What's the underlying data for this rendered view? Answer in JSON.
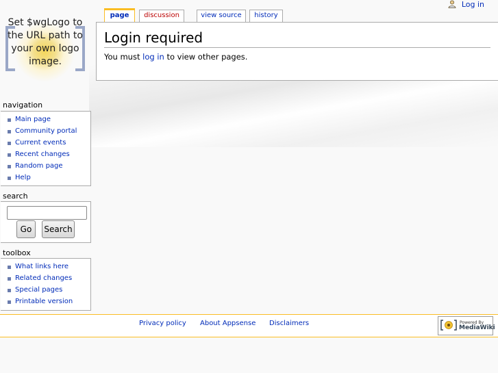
{
  "logo": {
    "text": "Set $wgLogo to the URL path to your own logo image."
  },
  "personal": {
    "login": "Log in"
  },
  "tabs": [
    {
      "label": "page"
    },
    {
      "label": "discussion"
    },
    {
      "label": "view source"
    },
    {
      "label": "history"
    }
  ],
  "content": {
    "title": "Login required",
    "body_pre": "You must ",
    "body_link": "log in",
    "body_post": " to view other pages."
  },
  "navigation": {
    "title": "navigation",
    "items": [
      "Main page",
      "Community portal",
      "Current events",
      "Recent changes",
      "Random page",
      "Help"
    ]
  },
  "search": {
    "title": "search",
    "go_label": "Go",
    "search_label": "Search",
    "placeholder": ""
  },
  "toolbox": {
    "title": "toolbox",
    "items": [
      "What links here",
      "Related changes",
      "Special pages",
      "Printable version"
    ]
  },
  "footer": {
    "links": [
      "Privacy policy",
      "About Appsense",
      "Disclaimers"
    ],
    "powered_small": "Powered By",
    "powered_big": "MediaWiki"
  }
}
